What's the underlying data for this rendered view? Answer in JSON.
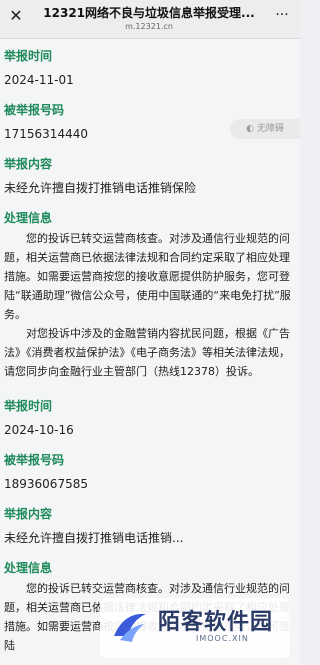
{
  "topbar": {
    "title": "12321网络不良与垃圾信息举报受理...",
    "url": "m.12321.cn",
    "close_glyph": "✕",
    "more_glyph": "···"
  },
  "sidebar": {
    "label": "无障碍",
    "icon": "accessibility-icon"
  },
  "records": [
    {
      "time_label": "举报时间",
      "time_value": "2024-11-01",
      "number_label": "被举报号码",
      "number_value": "17156314440",
      "content_label": "举报内容",
      "content_value": "未经允许擅自拨打推销电话推销保险",
      "handle_label": "处理信息",
      "handle_para1": "您的投诉已转交运营商核查。对涉及通信行业规范的问题，相关运营商已依据法律法规和合同约定采取了相应处理措施。如需要运营商按您的接收意愿提供防护服务，您可登陆“联通助理”微信公众号，使用中国联通的“来电免打扰”服务。",
      "handle_para2": "对您投诉中涉及的金融营销内容扰民问题，根据《广告法》《消费者权益保护法》《电子商务法》等相关法律法规，请您同步向金融行业主管部门（热线12378）投诉。"
    },
    {
      "time_label": "举报时间",
      "time_value": "2024-10-16",
      "number_label": "被举报号码",
      "number_value": "18936067585",
      "content_label": "举报内容",
      "content_value": "未经允许擅自拨打推销电话推销...",
      "handle_label": "处理信息",
      "handle_para1": "您的投诉已转交运营商核查。对涉及通信行业规范的问题，相关运营商已依据法律法规和合同约定采取了相应处理措施。如需要运营商按您的接收意愿提供防护服务，您可登陆",
      "handle_para2": ""
    }
  ],
  "watermark": {
    "brand": "陌客软件园",
    "sub": "IMOOC.XIN"
  }
}
